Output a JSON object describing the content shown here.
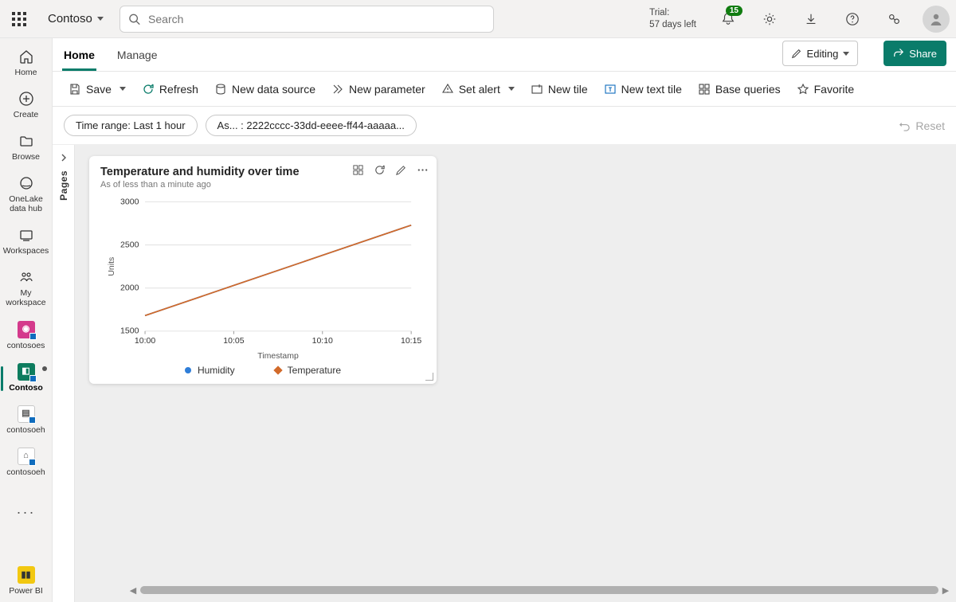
{
  "header": {
    "brand": "Contoso",
    "search_placeholder": "Search",
    "trial_label": "Trial:",
    "trial_value": "57 days left",
    "notification_badge": "15"
  },
  "leftnav": {
    "items": [
      {
        "label": "Home"
      },
      {
        "label": "Create"
      },
      {
        "label": "Browse"
      },
      {
        "label": "OneLake data hub"
      },
      {
        "label": "Workspaces"
      },
      {
        "label": "My workspace"
      },
      {
        "label": "contosoes"
      },
      {
        "label": "Contoso"
      },
      {
        "label": "contosoeh"
      },
      {
        "label": "contosoeh"
      }
    ],
    "footer_label": "Power BI"
  },
  "tabs": {
    "items": [
      "Home",
      "Manage"
    ],
    "active": "Home",
    "editing_label": "Editing",
    "share_label": "Share"
  },
  "toolbar": {
    "save": "Save",
    "refresh": "Refresh",
    "new_data_source": "New data source",
    "new_parameter": "New parameter",
    "set_alert": "Set alert",
    "new_tile": "New tile",
    "new_text_tile": "New text tile",
    "base_queries": "Base queries",
    "favorite": "Favorite"
  },
  "filters": {
    "time_range": "Time range: Last 1 hour",
    "asset": "As... : 2222cccc-33dd-eeee-ff44-aaaaa...",
    "reset": "Reset"
  },
  "pages_rail_label": "Pages",
  "tile": {
    "title": "Temperature and humidity over time",
    "subtitle": "As of less than a minute ago",
    "legend_humidity": "Humidity",
    "legend_temperature": "Temperature"
  },
  "chart_data": {
    "type": "line",
    "title": "Temperature and humidity over time",
    "xlabel": "Timestamp",
    "ylabel": "Units",
    "ylim": [
      1500,
      3000
    ],
    "y_ticks": [
      1500,
      2000,
      2500,
      3000
    ],
    "x": [
      "10:00",
      "10:05",
      "10:10",
      "10:15"
    ],
    "series": [
      {
        "name": "Humidity",
        "color": "#2f7ed8",
        "values": [
          1680,
          2030,
          2380,
          2730
        ]
      },
      {
        "name": "Temperature",
        "color": "#d26a2a",
        "values": [
          1680,
          2030,
          2380,
          2730
        ]
      }
    ]
  }
}
